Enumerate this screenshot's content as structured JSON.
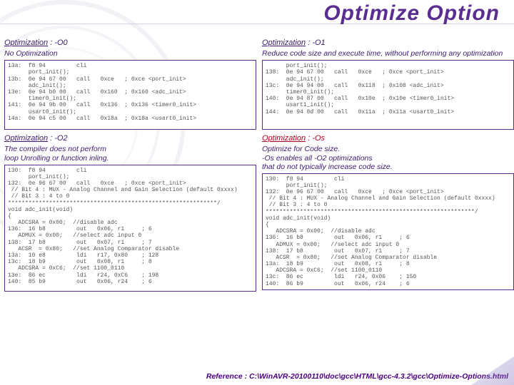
{
  "title": "Optimize Option",
  "sections": {
    "o0": {
      "label": "Optimization",
      "flag": ": -O0",
      "desc": "No Optimization",
      "code": "13a:  f8 94         cli\n      port_init();\n13b:  0e 94 67 00   call   0xce   ; 0xce <port_init>\n      adc_init();\n13e:  0e 94 b0 00   call   0x160  ; 0x160 <adc_init>\n      timer0_init();\n141:  0e 94 9b 00   call   0x136  ; 0x136 <timer0_init>\n      usart0_init();\n14a:  0e 94 c5 00   call   0x18a  ; 0x18a <usart0_init>"
    },
    "o1": {
      "label": "Optimization",
      "flag": ": -O1",
      "desc": "Reduce code size and execute time, without performing any optimization",
      "code": "      port_init();\n138:  0e 94 67 00   call   0xce   ; 0xce <port_init>\n      adc_init();\n13c:  0e 94 94 00   call   0x118  ; 0x108 <adc_init>\n      timer0_init();\n140:  0e 94 87 00   call   0x10e  ; 0x10e <timer0_init>\n      usart1_init();\n144:  0e 94 8d 00   call   0x11a  ; 0x11a <usart0_init>"
    },
    "o2": {
      "label": "Optimization",
      "flag": ": -O2",
      "desc": "The compiler does not perform\nloop Unrolling or function inling.",
      "code": "130:  f8 94         cli\n      port_init();\n132:  0e 96 67 00   call   0xce   ; 0xce <port_init>\n // Bit 4 : MUX - Analog Channel and Gain Selection (default 0xxxx)\n // Bit 3 : 4 to 0\n*************************************************************/\nvoid adc_init(void)\n{\n   ADCSRA = 0x00;  //disable adc\n136:  16 b8         out   0x06, r1     ; 6\n   ADMUX = 0x00;   //select adc input 0\n138:  17 b8         out   0x07, r1     ; 7\n   ACSR  = 0x80;   //set Analog Comparator disable\n13a:  10 e8         ldi   r17, 0x80    ; 128\n13c:  18 b9         out   0x08, r1     ; 8\n   ADCSRA = 0xC6;  //set 1100_0110\n13e:  86 ec         ldi   r24, 0xC6    ; 198\n140:  85 b9         out   0x06, r24    ; 6"
    },
    "os": {
      "label": "Optimization",
      "flag": ": -Os",
      "desc": "Optimize for Code size.\n-Os enables all -O2 optimizations\nthat do not typically increase code size.",
      "code": "130:  f8 94         cli\n      port_init();\n132:  0e 96 67 00   call   0xce   ; 0xce <port_init>\n // Bit 4 : MUX - Analog Channel and Gain Selection (default 0xxxx)\n // Bit 3 : 4 to 0\n*************************************************************/\nvoid adc_init(void)\n{\n   ADCSRA = 0x00;  //disable adc\n136:  16 b8         out   0x06, r1     ; 6\n   ADMUX = 0x00;   //select adc input 0\n138:  17 b8         out   0x07, r1     ; 7\n   ACSR  = 0x80;   //set Analog Comparator disable\n13a:  18 b9         out   0x08, r1     ; 8\n   ADCSRA = 0xC6;  //set 1100_0110\n13c:  86 ec         ldi   r24, 0x06    ; 150\n140:  86 b9         out   0x06, r24    ; 6"
    }
  },
  "reference": "Reference : C:\\WinAVR-20100110\\doc\\gcc\\HTML\\gcc-4.3.2\\gcc\\Optimize-Options.html"
}
